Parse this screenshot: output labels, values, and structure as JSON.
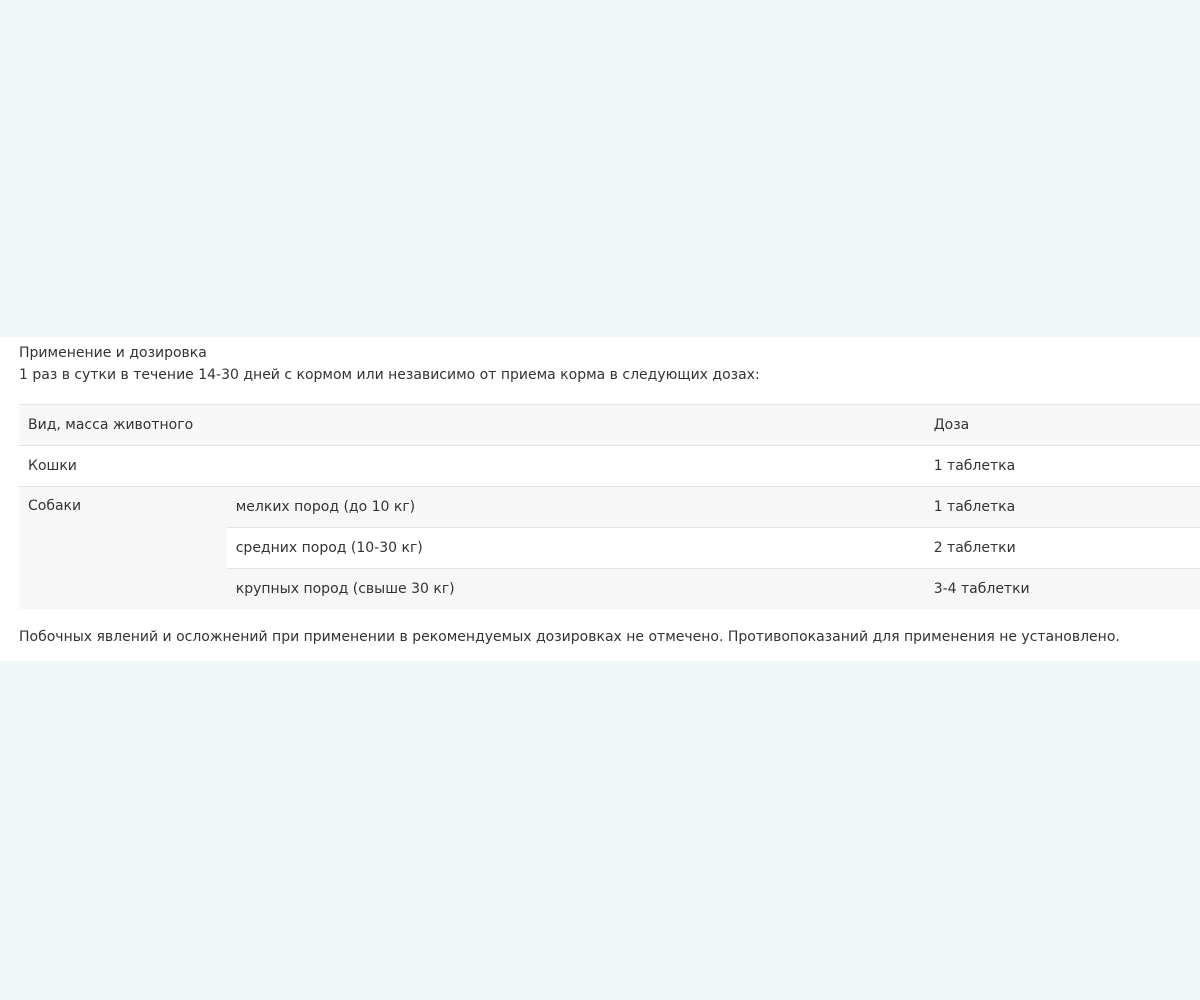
{
  "section": {
    "title": "Применение и дозировка",
    "description": "1 раз в сутки в течение 14-30 дней с кормом или независимо от приема корма в следующих дозах:"
  },
  "dosage_table": {
    "headers": {
      "species": "Вид, масса животного",
      "dose": "Доза"
    },
    "rows": [
      {
        "species": "Кошки",
        "subtype": "",
        "dose": "1 таблетка"
      },
      {
        "species": "Собаки",
        "subtype": "мелких пород (до 10 кг)",
        "dose": "1 таблетка"
      },
      {
        "species": "",
        "subtype": "средних пород (10-30 кг)",
        "dose": "2 таблетки"
      },
      {
        "species": "",
        "subtype": "крупных пород (свыше 30 кг)",
        "dose": "3-4 таблетки"
      }
    ]
  },
  "footnote": "Побочных явлений и осложнений при применении в рекомендуемых дозировках не отмечено. Противопоказаний для применения не установлено."
}
